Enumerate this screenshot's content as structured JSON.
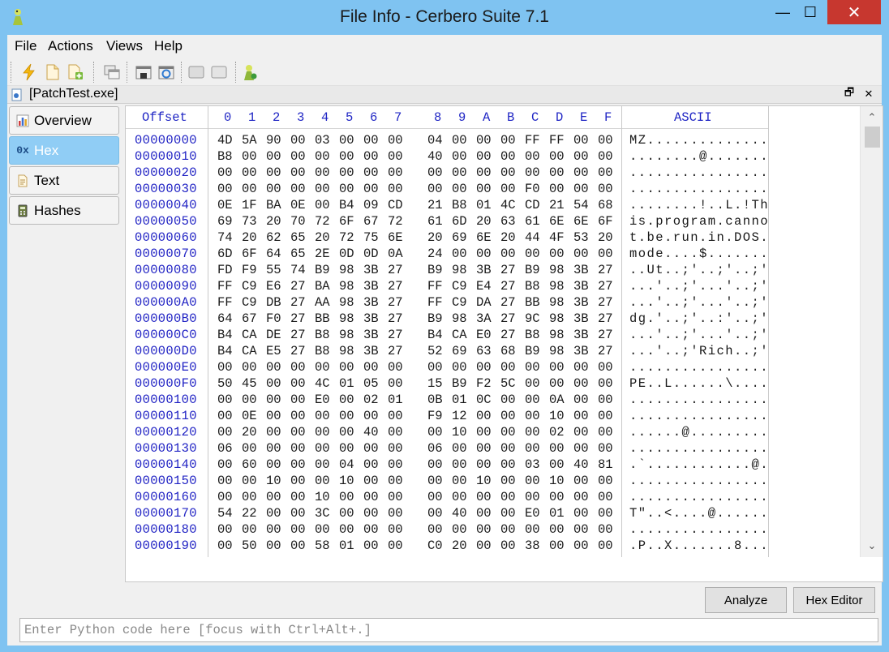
{
  "window": {
    "title": "File Info - Cerbero Suite 7.1",
    "min_glyph": "—",
    "max_glyph": "☐",
    "close_glyph": "✕"
  },
  "menu": [
    "File",
    "Actions",
    "Views",
    "Help"
  ],
  "toolbar": {
    "icons": [
      "bolt-icon",
      "new-file-icon",
      "add-file-icon",
      "windows-icon",
      "save-icon",
      "refresh-icon",
      "panel-icon",
      "panel-alt-icon",
      "run-icon"
    ]
  },
  "document": {
    "title": "[PatchTest.exe]",
    "restore_glyph": "🗗",
    "close_glyph": "✕"
  },
  "sidebar": {
    "items": [
      {
        "label": "Overview",
        "icon": "chart-icon",
        "active": false
      },
      {
        "label": "Hex",
        "icon": "hex-icon",
        "icon_text": "0x",
        "active": true
      },
      {
        "label": "Text",
        "icon": "text-file-icon",
        "active": false
      },
      {
        "label": "Hashes",
        "icon": "calculator-icon",
        "active": false
      }
    ]
  },
  "hex": {
    "offset_header": "Offset",
    "ascii_header": "ASCII",
    "columns": [
      "0",
      "1",
      "2",
      "3",
      "4",
      "5",
      "6",
      "7",
      "8",
      "9",
      "A",
      "B",
      "C",
      "D",
      "E",
      "F"
    ],
    "rows": [
      {
        "offset": "00000000",
        "bytes": [
          "4D",
          "5A",
          "90",
          "00",
          "03",
          "00",
          "00",
          "00",
          "04",
          "00",
          "00",
          "00",
          "FF",
          "FF",
          "00",
          "00"
        ],
        "ascii": "MZ.............."
      },
      {
        "offset": "00000010",
        "bytes": [
          "B8",
          "00",
          "00",
          "00",
          "00",
          "00",
          "00",
          "00",
          "40",
          "00",
          "00",
          "00",
          "00",
          "00",
          "00",
          "00"
        ],
        "ascii": "........@......."
      },
      {
        "offset": "00000020",
        "bytes": [
          "00",
          "00",
          "00",
          "00",
          "00",
          "00",
          "00",
          "00",
          "00",
          "00",
          "00",
          "00",
          "00",
          "00",
          "00",
          "00"
        ],
        "ascii": "................"
      },
      {
        "offset": "00000030",
        "bytes": [
          "00",
          "00",
          "00",
          "00",
          "00",
          "00",
          "00",
          "00",
          "00",
          "00",
          "00",
          "00",
          "F0",
          "00",
          "00",
          "00"
        ],
        "ascii": "................"
      },
      {
        "offset": "00000040",
        "bytes": [
          "0E",
          "1F",
          "BA",
          "0E",
          "00",
          "B4",
          "09",
          "CD",
          "21",
          "B8",
          "01",
          "4C",
          "CD",
          "21",
          "54",
          "68"
        ],
        "ascii": "........!..L.!Th"
      },
      {
        "offset": "00000050",
        "bytes": [
          "69",
          "73",
          "20",
          "70",
          "72",
          "6F",
          "67",
          "72",
          "61",
          "6D",
          "20",
          "63",
          "61",
          "6E",
          "6E",
          "6F"
        ],
        "ascii": "is.program.canno"
      },
      {
        "offset": "00000060",
        "bytes": [
          "74",
          "20",
          "62",
          "65",
          "20",
          "72",
          "75",
          "6E",
          "20",
          "69",
          "6E",
          "20",
          "44",
          "4F",
          "53",
          "20"
        ],
        "ascii": "t.be.run.in.DOS."
      },
      {
        "offset": "00000070",
        "bytes": [
          "6D",
          "6F",
          "64",
          "65",
          "2E",
          "0D",
          "0D",
          "0A",
          "24",
          "00",
          "00",
          "00",
          "00",
          "00",
          "00",
          "00"
        ],
        "ascii": "mode....$......."
      },
      {
        "offset": "00000080",
        "bytes": [
          "FD",
          "F9",
          "55",
          "74",
          "B9",
          "98",
          "3B",
          "27",
          "B9",
          "98",
          "3B",
          "27",
          "B9",
          "98",
          "3B",
          "27"
        ],
        "ascii": "..Ut..;'..;'..;'"
      },
      {
        "offset": "00000090",
        "bytes": [
          "FF",
          "C9",
          "E6",
          "27",
          "BA",
          "98",
          "3B",
          "27",
          "FF",
          "C9",
          "E4",
          "27",
          "B8",
          "98",
          "3B",
          "27"
        ],
        "ascii": "...'..;'...'..;'"
      },
      {
        "offset": "000000A0",
        "bytes": [
          "FF",
          "C9",
          "DB",
          "27",
          "AA",
          "98",
          "3B",
          "27",
          "FF",
          "C9",
          "DA",
          "27",
          "BB",
          "98",
          "3B",
          "27"
        ],
        "ascii": "...'..;'...'..;'"
      },
      {
        "offset": "000000B0",
        "bytes": [
          "64",
          "67",
          "F0",
          "27",
          "BB",
          "98",
          "3B",
          "27",
          "B9",
          "98",
          "3A",
          "27",
          "9C",
          "98",
          "3B",
          "27"
        ],
        "ascii": "dg.'..;'..:'..;'"
      },
      {
        "offset": "000000C0",
        "bytes": [
          "B4",
          "CA",
          "DE",
          "27",
          "B8",
          "98",
          "3B",
          "27",
          "B4",
          "CA",
          "E0",
          "27",
          "B8",
          "98",
          "3B",
          "27"
        ],
        "ascii": "...'..;'...'..;'"
      },
      {
        "offset": "000000D0",
        "bytes": [
          "B4",
          "CA",
          "E5",
          "27",
          "B8",
          "98",
          "3B",
          "27",
          "52",
          "69",
          "63",
          "68",
          "B9",
          "98",
          "3B",
          "27"
        ],
        "ascii": "...'..;'Rich..;'"
      },
      {
        "offset": "000000E0",
        "bytes": [
          "00",
          "00",
          "00",
          "00",
          "00",
          "00",
          "00",
          "00",
          "00",
          "00",
          "00",
          "00",
          "00",
          "00",
          "00",
          "00"
        ],
        "ascii": "................"
      },
      {
        "offset": "000000F0",
        "bytes": [
          "50",
          "45",
          "00",
          "00",
          "4C",
          "01",
          "05",
          "00",
          "15",
          "B9",
          "F2",
          "5C",
          "00",
          "00",
          "00",
          "00"
        ],
        "ascii": "PE..L......\\...."
      },
      {
        "offset": "00000100",
        "bytes": [
          "00",
          "00",
          "00",
          "00",
          "E0",
          "00",
          "02",
          "01",
          "0B",
          "01",
          "0C",
          "00",
          "00",
          "0A",
          "00",
          "00"
        ],
        "ascii": "................"
      },
      {
        "offset": "00000110",
        "bytes": [
          "00",
          "0E",
          "00",
          "00",
          "00",
          "00",
          "00",
          "00",
          "F9",
          "12",
          "00",
          "00",
          "00",
          "10",
          "00",
          "00"
        ],
        "ascii": "................"
      },
      {
        "offset": "00000120",
        "bytes": [
          "00",
          "20",
          "00",
          "00",
          "00",
          "00",
          "40",
          "00",
          "00",
          "10",
          "00",
          "00",
          "00",
          "02",
          "00",
          "00"
        ],
        "ascii": "......@........."
      },
      {
        "offset": "00000130",
        "bytes": [
          "06",
          "00",
          "00",
          "00",
          "00",
          "00",
          "00",
          "00",
          "06",
          "00",
          "00",
          "00",
          "00",
          "00",
          "00",
          "00"
        ],
        "ascii": "................"
      },
      {
        "offset": "00000140",
        "bytes": [
          "00",
          "60",
          "00",
          "00",
          "00",
          "04",
          "00",
          "00",
          "00",
          "00",
          "00",
          "00",
          "03",
          "00",
          "40",
          "81"
        ],
        "ascii": ".`............@."
      },
      {
        "offset": "00000150",
        "bytes": [
          "00",
          "00",
          "10",
          "00",
          "00",
          "10",
          "00",
          "00",
          "00",
          "00",
          "10",
          "00",
          "00",
          "10",
          "00",
          "00"
        ],
        "ascii": "................"
      },
      {
        "offset": "00000160",
        "bytes": [
          "00",
          "00",
          "00",
          "00",
          "10",
          "00",
          "00",
          "00",
          "00",
          "00",
          "00",
          "00",
          "00",
          "00",
          "00",
          "00"
        ],
        "ascii": "................"
      },
      {
        "offset": "00000170",
        "bytes": [
          "54",
          "22",
          "00",
          "00",
          "3C",
          "00",
          "00",
          "00",
          "00",
          "40",
          "00",
          "00",
          "E0",
          "01",
          "00",
          "00"
        ],
        "ascii": "T\"..<....@......"
      },
      {
        "offset": "00000180",
        "bytes": [
          "00",
          "00",
          "00",
          "00",
          "00",
          "00",
          "00",
          "00",
          "00",
          "00",
          "00",
          "00",
          "00",
          "00",
          "00",
          "00"
        ],
        "ascii": "................"
      },
      {
        "offset": "00000190",
        "bytes": [
          "00",
          "50",
          "00",
          "00",
          "58",
          "01",
          "00",
          "00",
          "C0",
          "20",
          "00",
          "00",
          "38",
          "00",
          "00",
          "00"
        ],
        "ascii": ".P..X.......8..."
      }
    ]
  },
  "scrollbar": {
    "up_glyph": "⌃",
    "down_glyph": "⌄"
  },
  "buttons": {
    "analyze": "Analyze",
    "hex_editor": "Hex Editor"
  },
  "python": {
    "placeholder": "Enter Python code here [focus with Ctrl+Alt+.]"
  }
}
